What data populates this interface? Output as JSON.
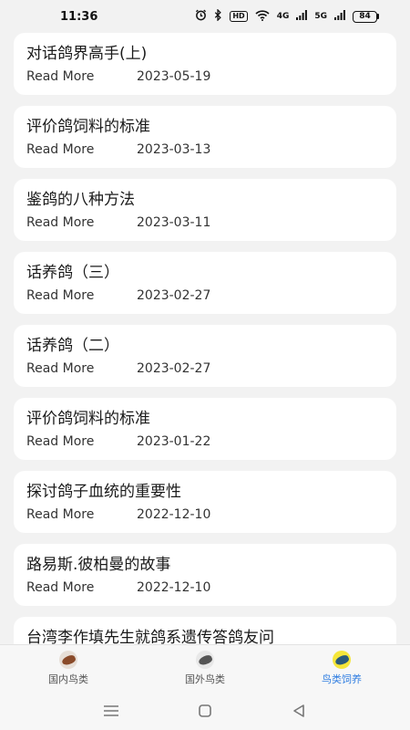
{
  "status": {
    "time": "11:36",
    "hd": "HD",
    "network1": "4G",
    "network2": "5G",
    "battery": "84"
  },
  "articles": [
    {
      "title": "对话鸽界高手(上)",
      "action": "Read More",
      "date": "2023-05-19"
    },
    {
      "title": "评价鸽饲料的标准",
      "action": "Read More",
      "date": "2023-03-13"
    },
    {
      "title": "鉴鸽的八种方法",
      "action": "Read More",
      "date": "2023-03-11"
    },
    {
      "title": "话养鸽（三）",
      "action": "Read More",
      "date": "2023-02-27"
    },
    {
      "title": "话养鸽（二）",
      "action": "Read More",
      "date": "2023-02-27"
    },
    {
      "title": "评价鸽饲料的标准",
      "action": "Read More",
      "date": "2023-01-22"
    },
    {
      "title": "探讨鸽子血统的重要性",
      "action": "Read More",
      "date": "2022-12-10"
    },
    {
      "title": "路易斯.彼柏曼的故事",
      "action": "Read More",
      "date": "2022-12-10"
    },
    {
      "title": "台湾李作填先生就鸽系遗传答鸽友问",
      "action": "",
      "date": ""
    }
  ],
  "nav": {
    "tabs": [
      {
        "label": "国内鸟类",
        "icon": "domestic-bird-icon",
        "active": false
      },
      {
        "label": "国外鸟类",
        "icon": "foreign-bird-icon",
        "active": false
      },
      {
        "label": "鸟类饲养",
        "icon": "bird-feeding-icon",
        "active": true
      }
    ]
  },
  "colors": {
    "accent": "#2f7de1",
    "background": "#f2f2f2",
    "card": "#ffffff"
  }
}
